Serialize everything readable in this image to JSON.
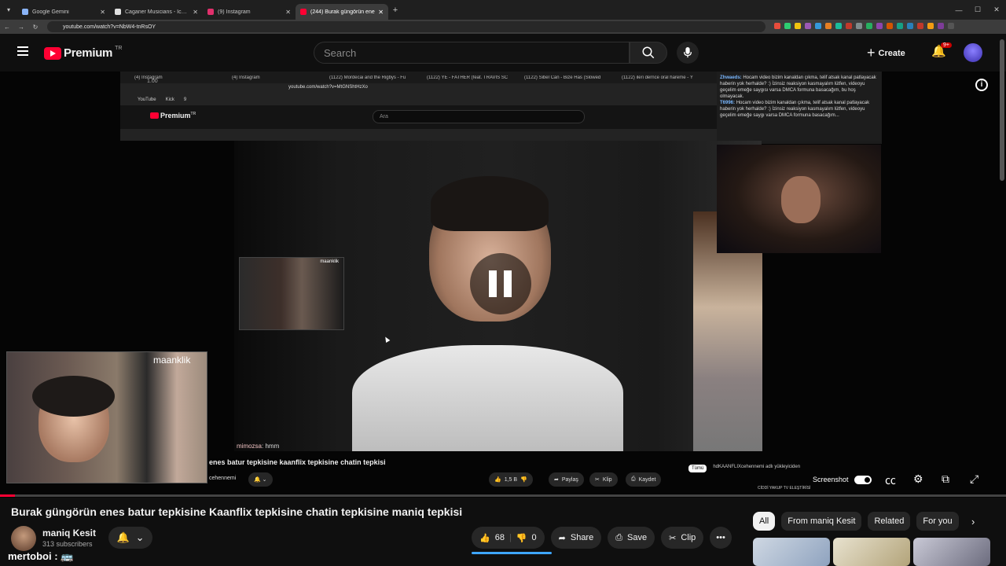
{
  "browser": {
    "tabs": [
      {
        "title": "Google Gemini",
        "color": "#8ab4f8",
        "active": false
      },
      {
        "title": "Caganer Musicians - Iconic Mu",
        "color": "#e0e0e0",
        "active": false
      },
      {
        "title": "(9) Instagram",
        "color": "#e1306c",
        "active": false
      },
      {
        "title": "(244) Burak güngörün ene",
        "color": "#ff0033",
        "active": true
      }
    ],
    "new_tab_label": "+",
    "url": "youtube.com/watch?v=NbW4-tnRsOY"
  },
  "youtube": {
    "brand": "Premium",
    "region": "TR",
    "search_placeholder": "Search",
    "create_label": "Create",
    "notif_badge": "9+"
  },
  "inner_screen": {
    "tabs": [
      "(4) Instagram",
      "(4) Instagram",
      "(1122) Mordecai and the Rigbys - Fu",
      "(1122) YE - FATHER (feat. TRAVIS SC",
      "(1122) Sibel Can - Bize Has (Slowed",
      "(1122) ileri dernce oral hareme - Y",
      "(1122) L..."
    ],
    "zoom": "1.00",
    "url": "youtube.com/watch?v=MtGNShtHzXo",
    "bookmarks": [
      "YouTube",
      "Kick",
      "9"
    ],
    "brand": "Premium",
    "region": "TR",
    "search_placeholder": "Ara",
    "chat_lines": [
      {
        "user": "Zhwaeds:",
        "text": "Hocam video bizim kanaldan çıkma, telif atsak kanal patlayacak haberin yok herhalde? :) İzinsiz reaksiyon kasmayalım lütfen, videoyu geçelim emeğe saygısı varsa DMCA formuna basacağım, bu hoş olmayacak."
      },
      {
        "user": "T6996:",
        "text": "Hocam video bizim kanaldan çıkma, telif atsak kanal patlayacak haberin yok herhalde? :) İzinsiz reaksiyon kasmayalım lütfen, videoyu geçelim emeğe saygı varsa DMCA formuna basacağım..."
      }
    ],
    "overlay_cam_label": "maanklik",
    "chat_message": {
      "user": "mimozsa",
      "text": ": hmm"
    },
    "video_title": "enes batur tepkisine kaanflix tepkisine chatin tepkisi",
    "channel_fragment": "cehennemi",
    "likes": "1,5 B",
    "share_label": "Paylaş",
    "clip_label": "Klip",
    "save_label": "Kaydet",
    "chips": [
      "Tümü",
      "hdKAANFLIXcehennemi adlı yükleyiciden"
    ],
    "side_video": "CİDDİ YAKUP TV ELEŞTİRİSİ"
  },
  "player": {
    "streamer_cam_label": "maanklik",
    "screenshot_label": "Screenshot",
    "progress_pct": 1.5
  },
  "video": {
    "title": "Burak güngörün enes batur tepkisine Kaanflix tepkisine chatin tepkisine maniq tepkisi",
    "channel": "maniq Kesit",
    "subscribers": "313 subscribers",
    "likes": "68",
    "dislikes": "0",
    "share": "Share",
    "save": "Save",
    "clip": "Clip"
  },
  "chat_overlay_text": "mertoboi : 🚌",
  "chips": [
    {
      "label": "All",
      "active": true
    },
    {
      "label": "From maniq Kesit",
      "active": false
    },
    {
      "label": "Related",
      "active": false
    },
    {
      "label": "For you",
      "active": false
    }
  ]
}
